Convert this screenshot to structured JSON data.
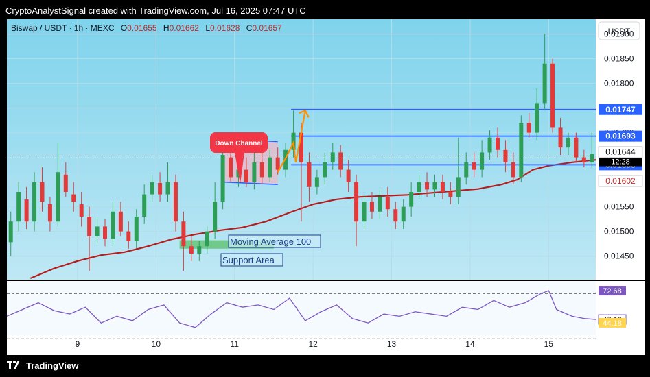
{
  "header": {
    "text": "CryptoAnalystSignal created with TradingView.com, Jul 16, 2025 07:47 UTC"
  },
  "footer": {
    "brand": "TradingView"
  },
  "chart_data": {
    "type": "candlestick",
    "symbol_line": {
      "pair": "Biswap / USDT · 1h · MEXC",
      "o_label": "O",
      "o_value": "0.01655",
      "h_label": "H",
      "h_value": "0.01662",
      "l_label": "L",
      "l_value": "0.01628",
      "c_label": "C",
      "c_value": "0.01657"
    },
    "currency_button": "USDT",
    "ylim": [
      0.01405,
      0.0193
    ],
    "y_ticks": [
      "0.01900",
      "0.01850",
      "0.01800",
      "0.01750",
      "0.01700",
      "0.01650",
      "0.01600",
      "0.01550",
      "0.01500",
      "0.01450"
    ],
    "y_tick_values": [
      0.019,
      0.0185,
      0.018,
      0.0175,
      0.017,
      0.0165,
      0.016,
      0.0155,
      0.015,
      0.0145
    ],
    "x_ticks": [
      "9",
      "10",
      "11",
      "12",
      "13",
      "14",
      "15"
    ],
    "x_tick_days": [
      9,
      10,
      11,
      12,
      13,
      14,
      15
    ],
    "x_range_days": [
      8.1,
      15.6
    ],
    "horizontal_levels": [
      {
        "price": 0.01747,
        "label": "0.01747",
        "color": "#2962ff"
      },
      {
        "price": 0.01693,
        "label": "0.01693",
        "color": "#2962ff"
      },
      {
        "price": 0.01635,
        "label": "0.01635",
        "color": "#2962ff"
      }
    ],
    "price_badges": [
      {
        "price": 0.01657,
        "label": "0.01657",
        "sub": "12:28",
        "bg": "#000000",
        "fg": "#ffffff"
      },
      {
        "price": 0.01644,
        "label": "0.01644",
        "bg": "#ffffff",
        "fg": "#000000"
      },
      {
        "price": 0.01602,
        "label": "0.01602",
        "bg": "#ffffff",
        "fg": "#c62828"
      }
    ],
    "annotations": {
      "down_channel": "Down Channel",
      "moving_average": "Moving Average 100",
      "support_area": "Support Area"
    },
    "ma100": [
      [
        8.4,
        0.01405
      ],
      [
        8.7,
        0.01425
      ],
      [
        9.0,
        0.0144
      ],
      [
        9.3,
        0.01452
      ],
      [
        9.6,
        0.01458
      ],
      [
        9.9,
        0.0147
      ],
      [
        10.2,
        0.01484
      ],
      [
        10.5,
        0.01494
      ],
      [
        10.8,
        0.01502
      ],
      [
        11.1,
        0.01508
      ],
      [
        11.4,
        0.0152
      ],
      [
        11.7,
        0.01538
      ],
      [
        12.0,
        0.01555
      ],
      [
        12.3,
        0.01565
      ],
      [
        12.6,
        0.0157
      ],
      [
        12.9,
        0.01572
      ],
      [
        13.2,
        0.01574
      ],
      [
        13.5,
        0.01578
      ],
      [
        13.8,
        0.01582
      ],
      [
        14.1,
        0.01586
      ],
      [
        14.4,
        0.01595
      ],
      [
        14.6,
        0.01605
      ],
      [
        14.8,
        0.01625
      ],
      [
        15.0,
        0.01633
      ],
      [
        15.3,
        0.0164
      ],
      [
        15.6,
        0.01645
      ]
    ],
    "candles": [
      [
        8.15,
        0.01478,
        0.0152,
        0.0147,
        0.0154,
        0.0145
      ],
      [
        8.25,
        0.0152,
        0.0158,
        0.01512,
        0.016,
        0.015
      ],
      [
        8.35,
        0.01565,
        0.0152,
        0.0157,
        0.01505,
        0.0159
      ],
      [
        8.45,
        0.0152,
        0.016,
        0.01512,
        0.0162,
        0.015
      ],
      [
        8.55,
        0.016,
        0.0156,
        0.0161,
        0.0154,
        0.0163
      ],
      [
        8.65,
        0.01555,
        0.0152,
        0.0156,
        0.015,
        0.0157
      ],
      [
        8.75,
        0.0152,
        0.0162,
        0.01515,
        0.0168,
        0.0151
      ],
      [
        8.85,
        0.01615,
        0.0158,
        0.01625,
        0.0157,
        0.0164
      ],
      [
        8.95,
        0.01575,
        0.0156,
        0.0158,
        0.0154,
        0.016
      ],
      [
        9.05,
        0.01555,
        0.0153,
        0.0156,
        0.0151,
        0.0158
      ],
      [
        9.15,
        0.0153,
        0.0149,
        0.0154,
        0.0142,
        0.0155
      ],
      [
        9.25,
        0.0149,
        0.0151,
        0.01485,
        0.0153,
        0.01475
      ],
      [
        9.35,
        0.0151,
        0.01485,
        0.01512,
        0.0147,
        0.01525
      ],
      [
        9.45,
        0.01485,
        0.0154,
        0.0148,
        0.0156,
        0.0147
      ],
      [
        9.55,
        0.0154,
        0.015,
        0.01545,
        0.0149,
        0.0156
      ],
      [
        9.65,
        0.015,
        0.0148,
        0.01505,
        0.01465,
        0.0152
      ],
      [
        9.75,
        0.0148,
        0.0153,
        0.01475,
        0.01545,
        0.01465
      ],
      [
        9.85,
        0.0153,
        0.01575,
        0.01525,
        0.01595,
        0.01515
      ],
      [
        9.95,
        0.01575,
        0.016,
        0.0157,
        0.01615,
        0.0156
      ],
      [
        10.05,
        0.01598,
        0.01575,
        0.01605,
        0.0156,
        0.0162
      ],
      [
        10.15,
        0.01575,
        0.016,
        0.0157,
        0.0164,
        0.0156
      ],
      [
        10.25,
        0.016,
        0.0152,
        0.01605,
        0.015,
        0.01615
      ],
      [
        10.35,
        0.0152,
        0.0147,
        0.01525,
        0.0142,
        0.0154
      ],
      [
        10.45,
        0.0147,
        0.01455,
        0.01475,
        0.0144,
        0.0149
      ],
      [
        10.55,
        0.01455,
        0.0147,
        0.0145,
        0.0148,
        0.0144
      ],
      [
        10.65,
        0.0147,
        0.015,
        0.01465,
        0.0151,
        0.01455
      ],
      [
        10.75,
        0.015,
        0.0156,
        0.01495,
        0.016,
        0.01485
      ],
      [
        10.85,
        0.0156,
        0.01655,
        0.01555,
        0.0169,
        0.01545
      ],
      [
        10.95,
        0.0165,
        0.0161,
        0.0166,
        0.016,
        0.0168
      ],
      [
        11.05,
        0.0161,
        0.01625,
        0.016,
        0.0164,
        0.0159
      ],
      [
        11.15,
        0.01625,
        0.016,
        0.0163,
        0.0159,
        0.0165
      ],
      [
        11.25,
        0.016,
        0.0164,
        0.01595,
        0.0166,
        0.01585
      ],
      [
        11.35,
        0.0164,
        0.0161,
        0.01645,
        0.01595,
        0.0166
      ],
      [
        11.45,
        0.0161,
        0.0165,
        0.01605,
        0.01665,
        0.016
      ],
      [
        11.55,
        0.0165,
        0.01625,
        0.01655,
        0.01615,
        0.0167
      ],
      [
        11.65,
        0.01625,
        0.01665,
        0.0162,
        0.0168,
        0.0161
      ],
      [
        11.75,
        0.01665,
        0.017,
        0.0166,
        0.01745,
        0.0165
      ],
      [
        11.85,
        0.017,
        0.0164,
        0.01705,
        0.0152,
        0.0172
      ],
      [
        11.95,
        0.0164,
        0.0159,
        0.01645,
        0.0156,
        0.0166
      ],
      [
        12.05,
        0.0159,
        0.0161,
        0.01585,
        0.01625,
        0.01575
      ],
      [
        12.15,
        0.0161,
        0.0164,
        0.01605,
        0.0166,
        0.01595
      ],
      [
        12.25,
        0.0164,
        0.0166,
        0.01635,
        0.0168,
        0.01625
      ],
      [
        12.35,
        0.0166,
        0.01625,
        0.01665,
        0.0161,
        0.01675
      ],
      [
        12.45,
        0.01625,
        0.016,
        0.0163,
        0.0158,
        0.01645
      ],
      [
        12.55,
        0.016,
        0.0152,
        0.01605,
        0.0147,
        0.01615
      ],
      [
        12.65,
        0.0152,
        0.0156,
        0.01515,
        0.01575,
        0.01505
      ],
      [
        12.75,
        0.0156,
        0.0154,
        0.01565,
        0.01525,
        0.0158
      ],
      [
        12.85,
        0.0154,
        0.0157,
        0.01535,
        0.01585,
        0.01525
      ],
      [
        12.95,
        0.0157,
        0.01545,
        0.01575,
        0.0153,
        0.0159
      ],
      [
        13.05,
        0.01545,
        0.0152,
        0.0155,
        0.01505,
        0.0156
      ],
      [
        13.15,
        0.0152,
        0.0155,
        0.01515,
        0.01565,
        0.01505
      ],
      [
        13.25,
        0.0155,
        0.0158,
        0.01545,
        0.016,
        0.0153
      ],
      [
        13.35,
        0.0158,
        0.016,
        0.01575,
        0.01615,
        0.01565
      ],
      [
        13.45,
        0.016,
        0.01585,
        0.01605,
        0.0157,
        0.0162
      ],
      [
        13.55,
        0.01585,
        0.016,
        0.0158,
        0.01615,
        0.0157
      ],
      [
        13.65,
        0.016,
        0.0158,
        0.01605,
        0.01565,
        0.01615
      ],
      [
        13.75,
        0.0158,
        0.0157,
        0.01585,
        0.01555,
        0.016
      ],
      [
        13.85,
        0.0157,
        0.0161,
        0.01565,
        0.0169,
        0.01555
      ],
      [
        13.95,
        0.0161,
        0.0164,
        0.01605,
        0.0166,
        0.01595
      ],
      [
        14.05,
        0.0164,
        0.01625,
        0.01645,
        0.0161,
        0.0166
      ],
      [
        14.15,
        0.01625,
        0.0166,
        0.0162,
        0.01685,
        0.0161
      ],
      [
        14.25,
        0.0166,
        0.0169,
        0.01655,
        0.01705,
        0.01645
      ],
      [
        14.35,
        0.0169,
        0.01665,
        0.01695,
        0.0165,
        0.0171
      ],
      [
        14.45,
        0.01665,
        0.0164,
        0.0167,
        0.0162,
        0.01685
      ],
      [
        14.55,
        0.0164,
        0.0161,
        0.01645,
        0.01595,
        0.0166
      ],
      [
        14.65,
        0.0161,
        0.0172,
        0.01605,
        0.01735,
        0.016
      ],
      [
        14.75,
        0.0172,
        0.017,
        0.01725,
        0.0169,
        0.0174
      ],
      [
        14.85,
        0.017,
        0.0176,
        0.01695,
        0.0179,
        0.01685
      ],
      [
        14.95,
        0.0176,
        0.0184,
        0.01755,
        0.019,
        0.01745
      ],
      [
        15.05,
        0.0184,
        0.0171,
        0.01845,
        0.017,
        0.0185
      ],
      [
        15.15,
        0.0171,
        0.0167,
        0.01715,
        0.01655,
        0.0173
      ],
      [
        15.25,
        0.0167,
        0.0169,
        0.01665,
        0.017,
        0.01655
      ],
      [
        15.35,
        0.0169,
        0.0165,
        0.01695,
        0.0164,
        0.017
      ],
      [
        15.45,
        0.0165,
        0.0164,
        0.01655,
        0.0163,
        0.01665
      ],
      [
        15.55,
        0.0164,
        0.01657,
        0.0163,
        0.017,
        0.01628
      ]
    ],
    "rsi": {
      "ylim": [
        35,
        80
      ],
      "levels": [
        {
          "value": 72.68,
          "label": "72.68"
        },
        {
          "value": 47.12,
          "label": "47.12"
        },
        {
          "value": 44.18,
          "label": "44.18"
        }
      ],
      "bands": [
        70,
        30
      ],
      "series": [
        [
          8.1,
          50
        ],
        [
          8.3,
          56
        ],
        [
          8.5,
          62
        ],
        [
          8.7,
          55
        ],
        [
          8.9,
          52
        ],
        [
          9.1,
          58
        ],
        [
          9.3,
          44
        ],
        [
          9.5,
          50
        ],
        [
          9.7,
          46
        ],
        [
          9.9,
          56
        ],
        [
          10.1,
          60
        ],
        [
          10.3,
          44
        ],
        [
          10.5,
          40
        ],
        [
          10.7,
          52
        ],
        [
          10.9,
          62
        ],
        [
          11.1,
          58
        ],
        [
          11.3,
          60
        ],
        [
          11.5,
          56
        ],
        [
          11.7,
          66
        ],
        [
          11.9,
          46
        ],
        [
          12.1,
          54
        ],
        [
          12.3,
          60
        ],
        [
          12.5,
          48
        ],
        [
          12.7,
          44
        ],
        [
          12.9,
          52
        ],
        [
          13.1,
          50
        ],
        [
          13.3,
          54
        ],
        [
          13.5,
          52
        ],
        [
          13.7,
          50
        ],
        [
          13.9,
          58
        ],
        [
          14.1,
          56
        ],
        [
          14.3,
          64
        ],
        [
          14.5,
          58
        ],
        [
          14.7,
          62
        ],
        [
          14.9,
          70
        ],
        [
          15.0,
          72.68
        ],
        [
          15.1,
          56
        ],
        [
          15.3,
          50
        ],
        [
          15.45,
          48
        ],
        [
          15.6,
          47.12
        ]
      ]
    }
  }
}
